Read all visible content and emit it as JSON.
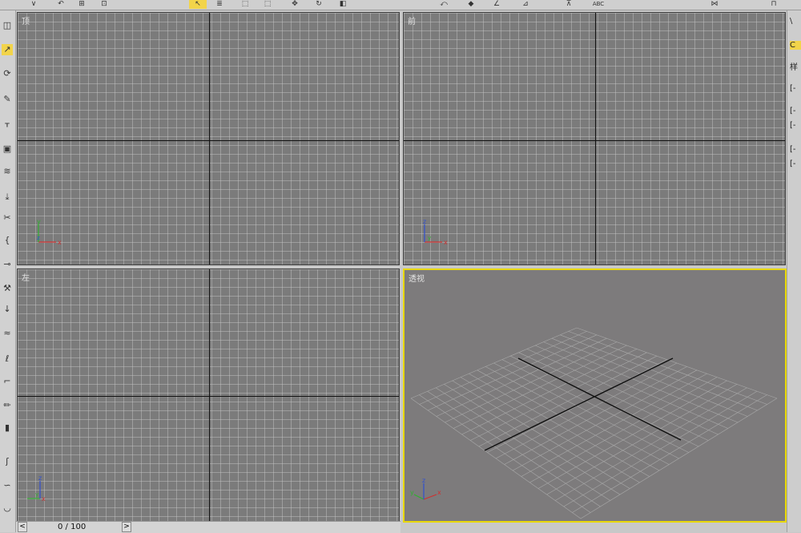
{
  "toolbar": {
    "items": [
      {
        "name": "select-icon",
        "glyph": "∨"
      },
      {
        "name": "undo-icon",
        "glyph": "↶"
      },
      {
        "name": "link-icon",
        "glyph": "⊞"
      },
      {
        "name": "bind-icon",
        "glyph": "⊡"
      },
      {
        "name": "select-object-icon",
        "glyph": "↖"
      },
      {
        "name": "select-by-name-icon",
        "glyph": "≣"
      },
      {
        "name": "region-select-icon",
        "glyph": "⬚"
      },
      {
        "name": "move-icon",
        "glyph": "✥"
      },
      {
        "name": "rotate-icon",
        "glyph": "↻"
      },
      {
        "name": "scale-icon",
        "glyph": "◧"
      },
      {
        "name": "pivot-icon",
        "glyph": "⤺"
      },
      {
        "name": "snap-icon",
        "glyph": "◆"
      },
      {
        "name": "angle-snap-icon",
        "glyph": "∠"
      },
      {
        "name": "percent-snap-icon",
        "glyph": "⊿"
      },
      {
        "name": "spinner-snap-icon",
        "glyph": "⊼"
      },
      {
        "name": "named-selection-text",
        "glyph": "ABC"
      },
      {
        "name": "mirror-icon",
        "glyph": "⋈"
      },
      {
        "name": "layer-icon",
        "glyph": "⊓"
      }
    ]
  },
  "viewports": {
    "top": {
      "label": "顶"
    },
    "front": {
      "label": "前"
    },
    "left": {
      "label": "左"
    },
    "perspective": {
      "label": "透视"
    }
  },
  "axes": {
    "x": "x",
    "y": "y",
    "z": "z"
  },
  "timeline": {
    "frame_text": "0 / 100",
    "prev": "<",
    "next": ">"
  },
  "colors": {
    "active_viewport_border": "#e8d800",
    "axis_x": "#d03030",
    "axis_y": "#30b030",
    "axis_z": "#3050d0"
  },
  "command_panel": {
    "tabs": [
      "\\",
      "C",
      "样",
      "[-",
      "[-",
      "[-",
      "[-",
      "[-"
    ]
  }
}
